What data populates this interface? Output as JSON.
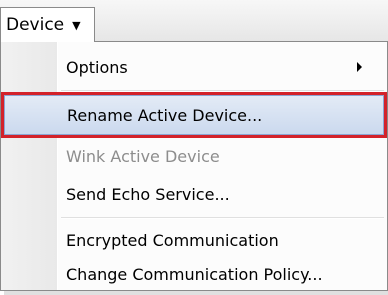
{
  "menubar": {
    "menu_label": "Device",
    "caret_icon": "caret-down-icon"
  },
  "dropdown": {
    "items": [
      {
        "label": "Options",
        "has_submenu": true,
        "enabled": true
      },
      {
        "label": "Rename Active Device...",
        "enabled": true,
        "highlighted": true
      },
      {
        "label": "Wink Active Device",
        "enabled": false
      },
      {
        "label": "Send Echo Service...",
        "enabled": true
      },
      {
        "label": "Encrypted Communication",
        "enabled": true
      },
      {
        "label": "Change Communication Policy...",
        "enabled": true
      }
    ]
  },
  "colors": {
    "highlight_border": "#d3222a",
    "highlight_fill": "#cbd9ee",
    "disabled_text": "#8d8d8d"
  }
}
